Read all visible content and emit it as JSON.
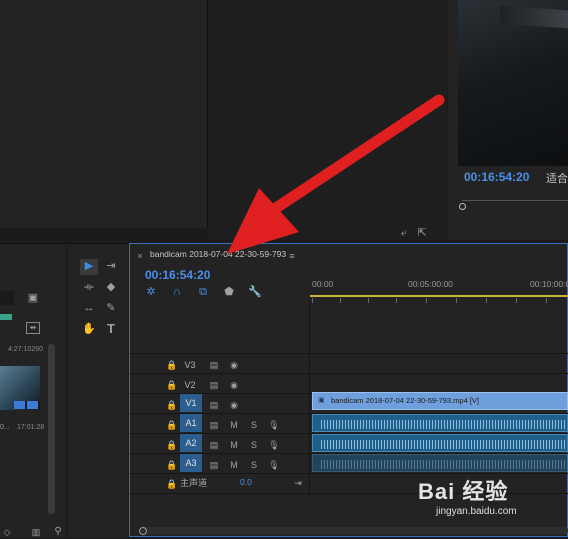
{
  "program": {
    "timecode": "00:16:54:20",
    "fit_label": "适合"
  },
  "project": {
    "duration1": "4:27:10260",
    "duration2": "17:01:28",
    "clip_prefix": "0..."
  },
  "timeline": {
    "sequence_title": "bandicam 2018-07-04 22-30-59-793",
    "timecode": "00:16:54:20",
    "ruler": [
      "00:00",
      "00:05:00:00",
      "00:10:00:0"
    ],
    "video_tracks": [
      "V3",
      "V2",
      "V1"
    ],
    "audio_tracks": [
      "A1",
      "A2",
      "A3"
    ],
    "track_buttons": {
      "mute": "M",
      "solo": "S"
    },
    "master_label": "主声道",
    "master_value": "0.0",
    "video_clip_label": "bandicam 2018-07-04 22-30-59-793.mp4 [V]"
  },
  "watermark": {
    "text": "Bai 经验",
    "url": "jingyan.baidu.com"
  },
  "colors": {
    "accent": "#4a8fe7",
    "arrow": "#e02020",
    "video_clip": "#6f9fdc",
    "audio_clip": "#1f5f89"
  }
}
